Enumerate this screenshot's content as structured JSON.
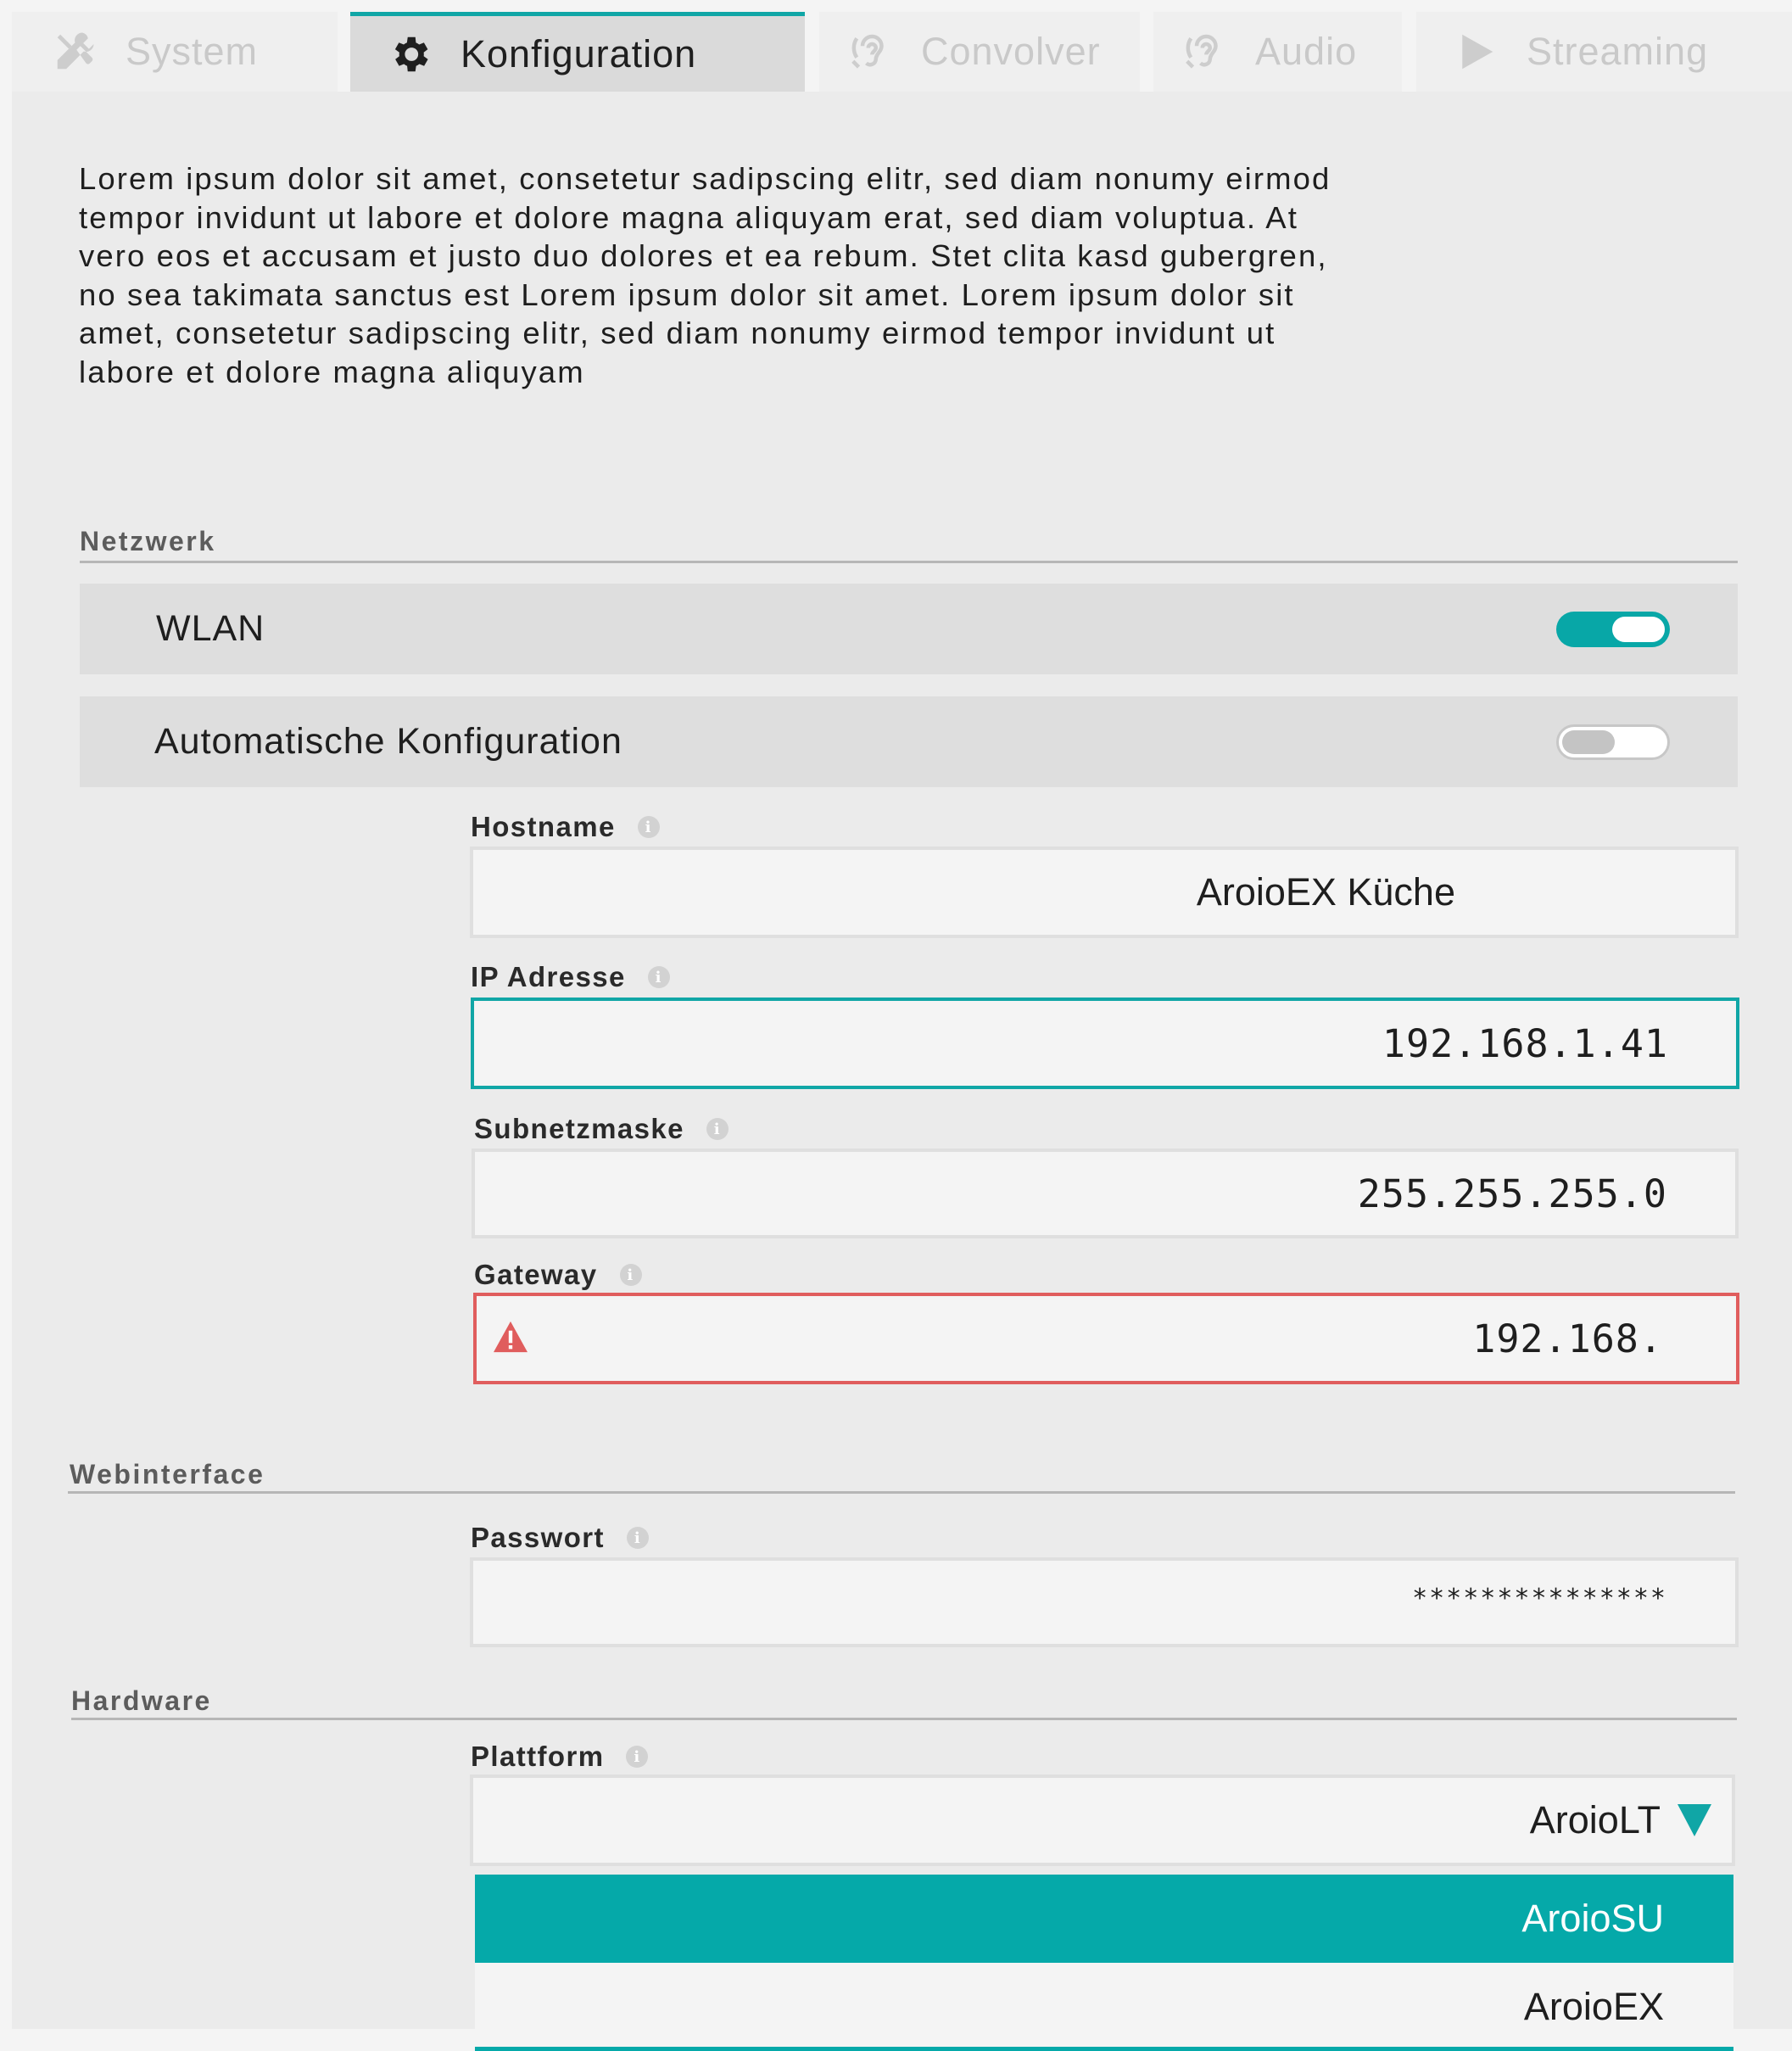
{
  "tabs": [
    {
      "label": "System",
      "icon": "tools-icon",
      "active": false
    },
    {
      "label": "Konfiguration",
      "icon": "gear-icon",
      "active": true
    },
    {
      "label": "Convolver",
      "icon": "ear-icon",
      "active": false
    },
    {
      "label": "Audio",
      "icon": "ear-icon",
      "active": false
    },
    {
      "label": "Streaming",
      "icon": "play-icon",
      "active": false
    }
  ],
  "description": "Lorem ipsum dolor sit amet, consetetur sadipscing elitr, sed diam nonumy eirmod tempor invidunt ut labore et dolore magna aliquyam erat, sed diam voluptua. At vero eos et accusam et justo duo dolores et ea rebum. Stet clita kasd gubergren, no sea takimata sanctus est Lorem ipsum dolor sit amet. Lorem ipsum dolor sit amet, consetetur sadipscing elitr, sed diam nonumy eirmod tempor invidunt ut labore et dolore magna aliquyam",
  "network": {
    "title": "Netzwerk",
    "wlan": {
      "label": "WLAN",
      "on": true
    },
    "auto_config": {
      "label": "Automatische Konfiguration",
      "on": false
    },
    "hostname": {
      "label": "Hostname",
      "value": "AroioEX Küche"
    },
    "ip": {
      "label": "IP Adresse",
      "value": "192.168.1.41",
      "state": "focused"
    },
    "subnet": {
      "label": "Subnetzmaske",
      "value": "255.255.255.0"
    },
    "gateway": {
      "label": "Gateway",
      "value": "192.168.",
      "state": "error"
    }
  },
  "webinterface": {
    "title": "Webinterface",
    "password": {
      "label": "Passwort",
      "value": "***************"
    }
  },
  "hardware": {
    "title": "Hardware",
    "platform": {
      "label": "Plattform",
      "value": "AroioLT",
      "options": [
        "AroioSU",
        "AroioEX"
      ],
      "highlighted": "AroioSU"
    }
  },
  "colors": {
    "accent": "#08a7a7",
    "error": "#e05d5d",
    "panel": "#ebebeb"
  }
}
